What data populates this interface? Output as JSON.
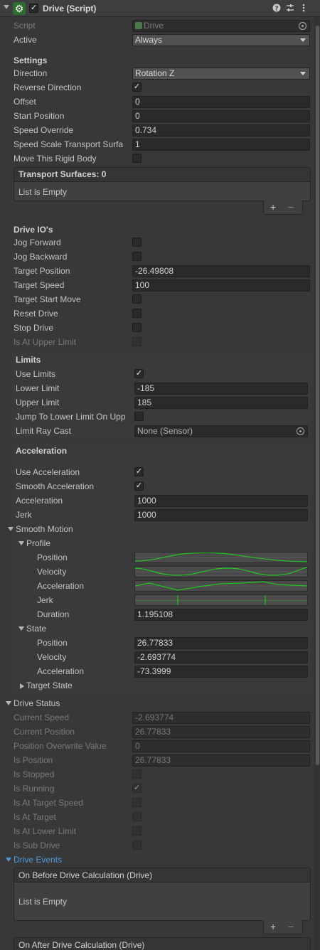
{
  "header": {
    "title": "Drive (Script)",
    "enabled": "✓",
    "icons": [
      "help-icon",
      "presets-icon",
      "menu-icon"
    ]
  },
  "script": {
    "label": "Script",
    "value": "Drive",
    "icon": "script-icon"
  },
  "active": {
    "label": "Active",
    "value": "Always"
  },
  "settings": {
    "title": "Settings",
    "direction": {
      "label": "Direction",
      "value": "Rotation Z"
    },
    "reverse_direction": {
      "label": "Reverse Direction",
      "checked": "✓"
    },
    "offset": {
      "label": "Offset",
      "value": "0"
    },
    "start_position": {
      "label": "Start Position",
      "value": "0"
    },
    "speed_override": {
      "label": "Speed Override",
      "value": "0.734"
    },
    "speed_scale": {
      "label": "Speed Scale Transport Surfa",
      "value": "1"
    },
    "move_rigid": {
      "label": "Move This Rigid Body"
    },
    "transport_surfaces": {
      "header": "Transport Surfaces: 0",
      "empty": "List is Empty",
      "add": "+",
      "remove": "−"
    }
  },
  "drive_ios": {
    "title": "Drive IO's",
    "jog_forward": "Jog Forward",
    "jog_backward": "Jog Backward",
    "target_position": {
      "label": "Target Position",
      "value": "-26.49808"
    },
    "target_speed": {
      "label": "Target Speed",
      "value": "100"
    },
    "target_start_move": "Target Start Move",
    "reset_drive": "Reset Drive",
    "stop_drive": "Stop Drive",
    "is_at_upper_limit": "Is At Upper Limit"
  },
  "limits": {
    "title": "Limits",
    "use_limits": {
      "label": "Use Limits",
      "checked": "✓"
    },
    "lower_limit": {
      "label": "Lower Limit",
      "value": "-185"
    },
    "upper_limit": {
      "label": "Upper Limit",
      "value": "185"
    },
    "jump_lower": "Jump To Lower Limit On Upp",
    "limit_ray_cast": {
      "label": "Limit Ray Cast",
      "value": "None (Sensor)"
    }
  },
  "acceleration": {
    "title": "Acceleration",
    "use_acceleration": {
      "label": "Use Acceleration",
      "checked": "✓"
    },
    "smooth_acceleration": {
      "label": "Smooth Acceleration",
      "checked": "✓"
    },
    "acceleration": {
      "label": "Acceleration",
      "value": "1000"
    },
    "jerk": {
      "label": "Jerk",
      "value": "1000"
    }
  },
  "smooth_motion": {
    "title": "Smooth Motion",
    "profile": {
      "title": "Profile",
      "position": "Position",
      "velocity": "Velocity",
      "acceleration": "Acceleration",
      "jerk": "Jerk",
      "duration": {
        "label": "Duration",
        "value": "1.195108"
      }
    },
    "state": {
      "title": "State",
      "position": {
        "label": "Position",
        "value": "26.77833"
      },
      "velocity": {
        "label": "Velocity",
        "value": "-2.693774"
      },
      "acceleration": {
        "label": "Acceleration",
        "value": "-73.3999"
      }
    },
    "target_state": "Target State"
  },
  "drive_status": {
    "title": "Drive Status",
    "current_speed": {
      "label": "Current Speed",
      "value": "-2.693774"
    },
    "current_position": {
      "label": "Current Position",
      "value": "26.77833"
    },
    "position_overwrite": {
      "label": "Position Overwrite Value",
      "value": "0"
    },
    "is_position": {
      "label": "Is Position",
      "value": "26.77833"
    },
    "is_stopped": "Is Stopped",
    "is_running": {
      "label": "Is Running",
      "checked": "✓"
    },
    "is_at_target_speed": "Is At Target Speed",
    "is_at_target": "Is At Target",
    "is_at_lower_limit": "Is At Lower Limit",
    "is_sub_drive": "Is Sub Drive"
  },
  "drive_events": {
    "title": "Drive Events",
    "before": {
      "header": "On Before Drive Calculation (Drive)",
      "empty": "List is Empty",
      "add": "+",
      "remove": "−"
    },
    "after": {
      "header": "On After Drive Calculation (Drive)"
    }
  },
  "colors": {
    "background": "#383838",
    "field": "#2a2a2a",
    "curve": "#22c322",
    "link": "#4e98d8"
  }
}
